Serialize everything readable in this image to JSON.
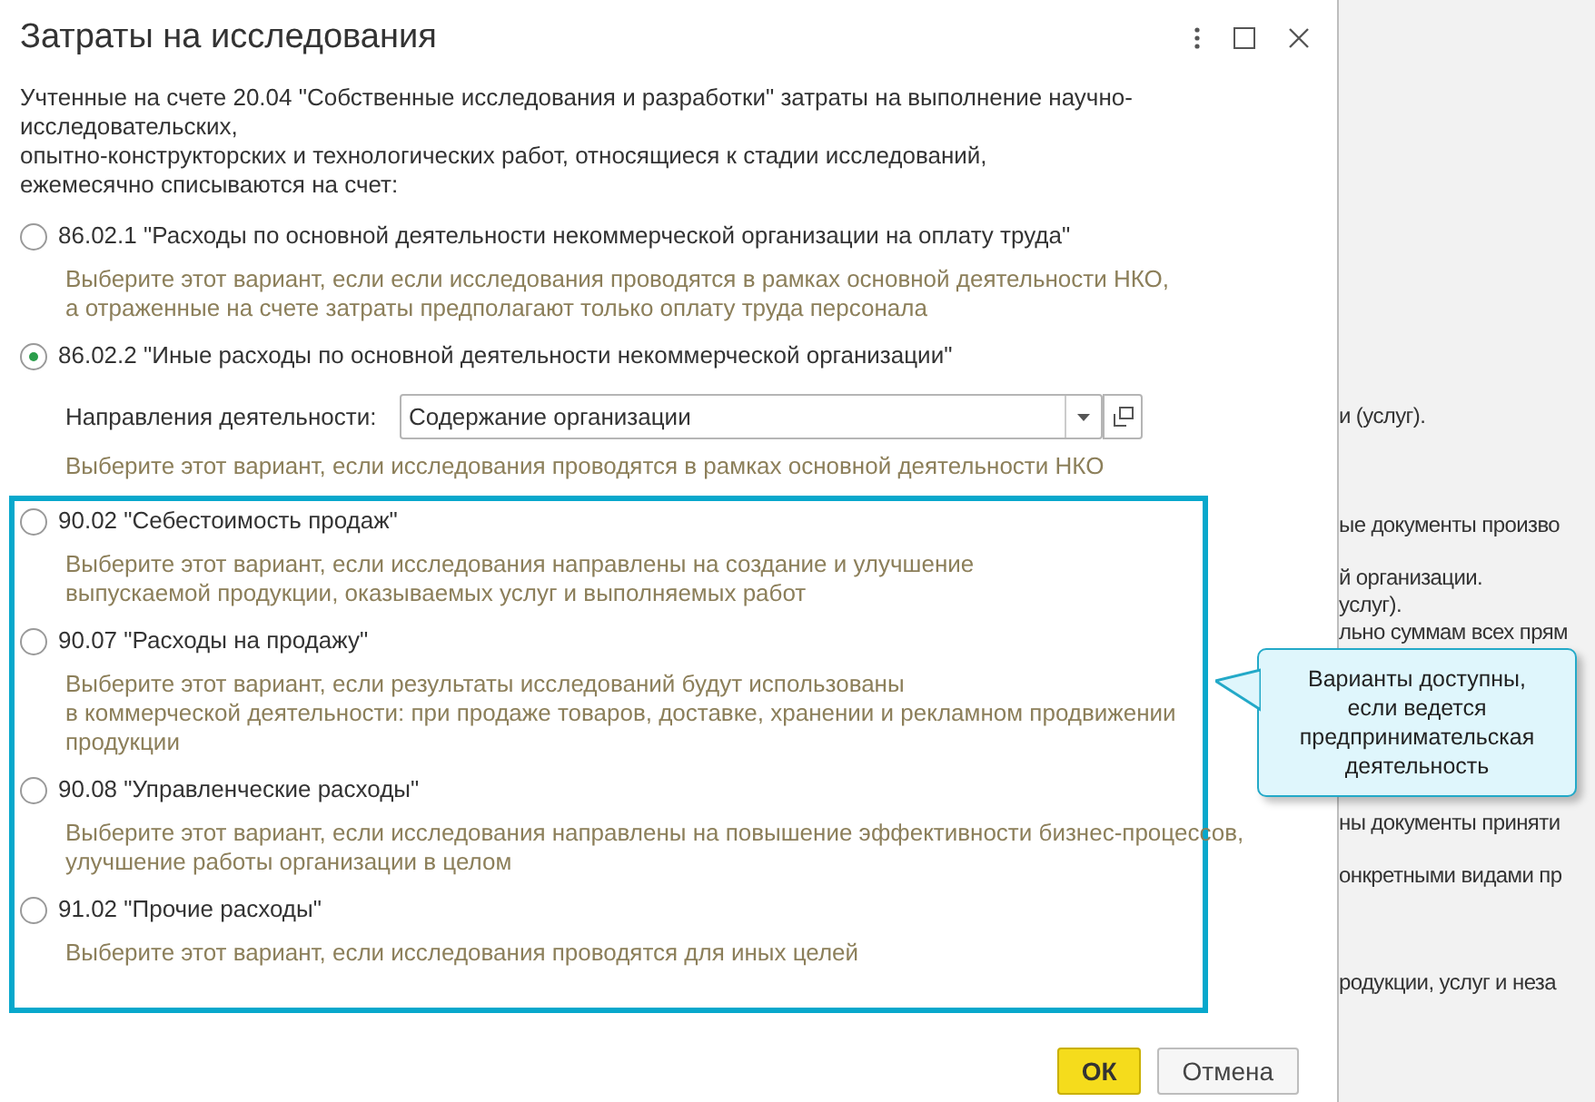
{
  "dialog": {
    "title": "Затраты на исследования",
    "intro": [
      "Учтенные на счете 20.04 \"Собственные исследования и разработки\" затраты на выполнение научно-",
      "исследовательских,",
      "опытно-конструкторских и технологических работ, относящиеся к стадии исследований,",
      "ежемесячно списываются на счет:"
    ],
    "options": [
      {
        "label": "86.02.1 \"Расходы по основной деятельности некоммерческой организации на оплату труда\"",
        "selected": false,
        "description": [
          "Выберите этот вариант, если если исследования проводятся в рамках основной деятельности НКО,",
          "а отраженные на счете затраты предполагают только оплату труда персонала"
        ]
      },
      {
        "label": "86.02.2 \"Иные расходы по основной деятельности некоммерческой организации\"",
        "selected": true,
        "field": {
          "label": "Направления деятельности:",
          "value": "Содержание организации"
        },
        "description": [
          "Выберите этот вариант, если исследования проводятся в рамках основной деятельности НКО"
        ]
      }
    ],
    "highlighted_options": [
      {
        "label": "90.02 \"Себестоимость продаж\"",
        "selected": false,
        "description": [
          "Выберите этот вариант, если исследования направлены на создание и улучшение",
          "выпускаемой продукции, оказываемых услуг и выполняемых работ"
        ]
      },
      {
        "label": "90.07 \"Расходы на продажу\"",
        "selected": false,
        "description": [
          "Выберите этот вариант, если результаты исследований будут использованы",
          "в коммерческой деятельности: при продаже товаров, доставке, хранении и рекламном продвижении",
          "продукции"
        ]
      },
      {
        "label": "90.08 \"Управленческие расходы\"",
        "selected": false,
        "description": [
          "Выберите этот вариант, если исследования направлены на повышение эффективности бизнес-процессов,",
          "улучшение работы организации в целом"
        ]
      },
      {
        "label": "91.02 \"Прочие расходы\"",
        "selected": false,
        "description": [
          "Выберите этот вариант, если исследования проводятся для иных целей"
        ]
      }
    ],
    "buttons": [
      {
        "label": "ОК",
        "kind": "primary"
      },
      {
        "label": "Отмена",
        "kind": "secondary"
      }
    ]
  },
  "background": {
    "lines": [
      "и (услуг).",
      "ые документы произво",
      "й организации.",
      "услуг).",
      "льно суммам всех прям",
      "ны документы приняти",
      "онкретными видами пр",
      "родукции, услуг и неза"
    ]
  },
  "callout": {
    "text": "Варианты доступны, если ведется предпринимательская деятельность"
  }
}
